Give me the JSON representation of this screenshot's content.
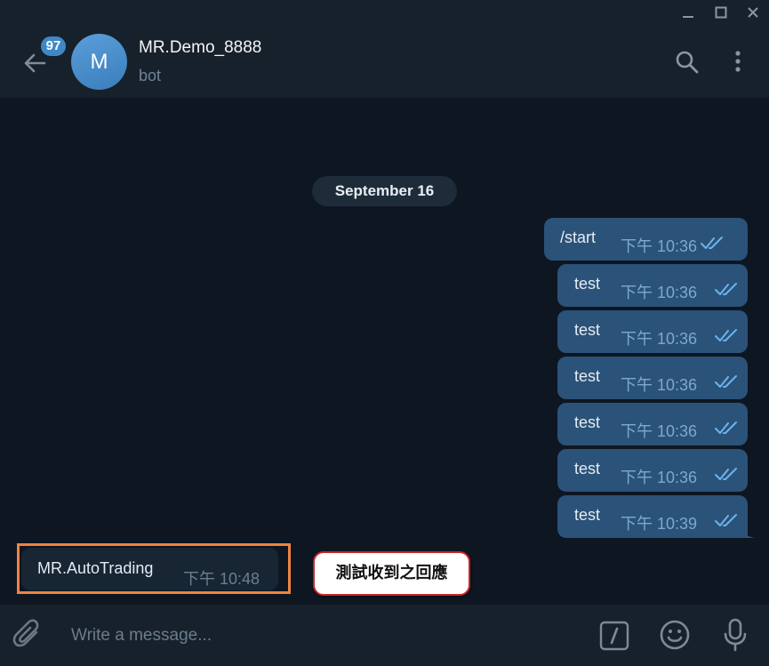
{
  "header": {
    "unread_count": "97",
    "avatar_letter": "M",
    "chat_name": "MR.Demo_8888",
    "chat_status": "bot"
  },
  "messages": {
    "date_separator": "September 16",
    "outgoing": [
      {
        "text": "/start",
        "time": "下午 10:36"
      },
      {
        "text": "test",
        "time": "下午 10:36"
      },
      {
        "text": "test",
        "time": "下午 10:36"
      },
      {
        "text": "test",
        "time": "下午 10:36"
      },
      {
        "text": "test",
        "time": "下午 10:36"
      },
      {
        "text": "test",
        "time": "下午 10:36"
      },
      {
        "text": "test",
        "time": "下午 10:39"
      }
    ],
    "incoming": {
      "text": "MR.AutoTrading",
      "time": "下午 10:48"
    },
    "annotation": "測試收到之回應"
  },
  "input": {
    "placeholder": "Write a message..."
  },
  "colors": {
    "background": "#0e1621",
    "panel": "#17212b",
    "outgoing_bubble": "#2b5278",
    "incoming_bubble": "#182533",
    "accent": "#3e88c7",
    "highlight": "#ee8443"
  }
}
